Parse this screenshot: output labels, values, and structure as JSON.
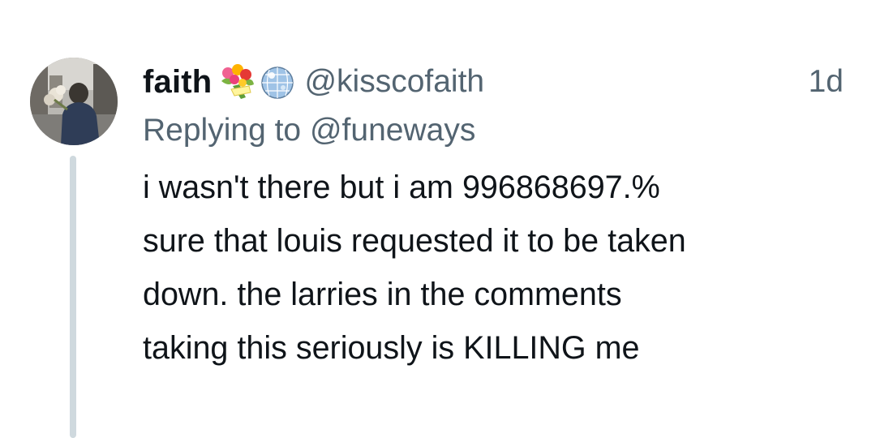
{
  "tweet": {
    "display_name": "faith",
    "emojis": [
      "bouquet-emoji",
      "mirror-ball-emoji"
    ],
    "handle": "@kisscofaith",
    "time": "1d",
    "replying_prefix": "Replying to",
    "replying_to": "@funeways",
    "body_lines": [
      "i wasn't there but i am 996868697.%",
      "sure that louis requested it to be taken",
      "down. the larries in the comments",
      "taking this seriously is KILLING me"
    ]
  },
  "colors": {
    "text_primary": "#0f1419",
    "text_secondary": "#536471",
    "thread_line": "#cfd9de",
    "background": "#ffffff"
  }
}
